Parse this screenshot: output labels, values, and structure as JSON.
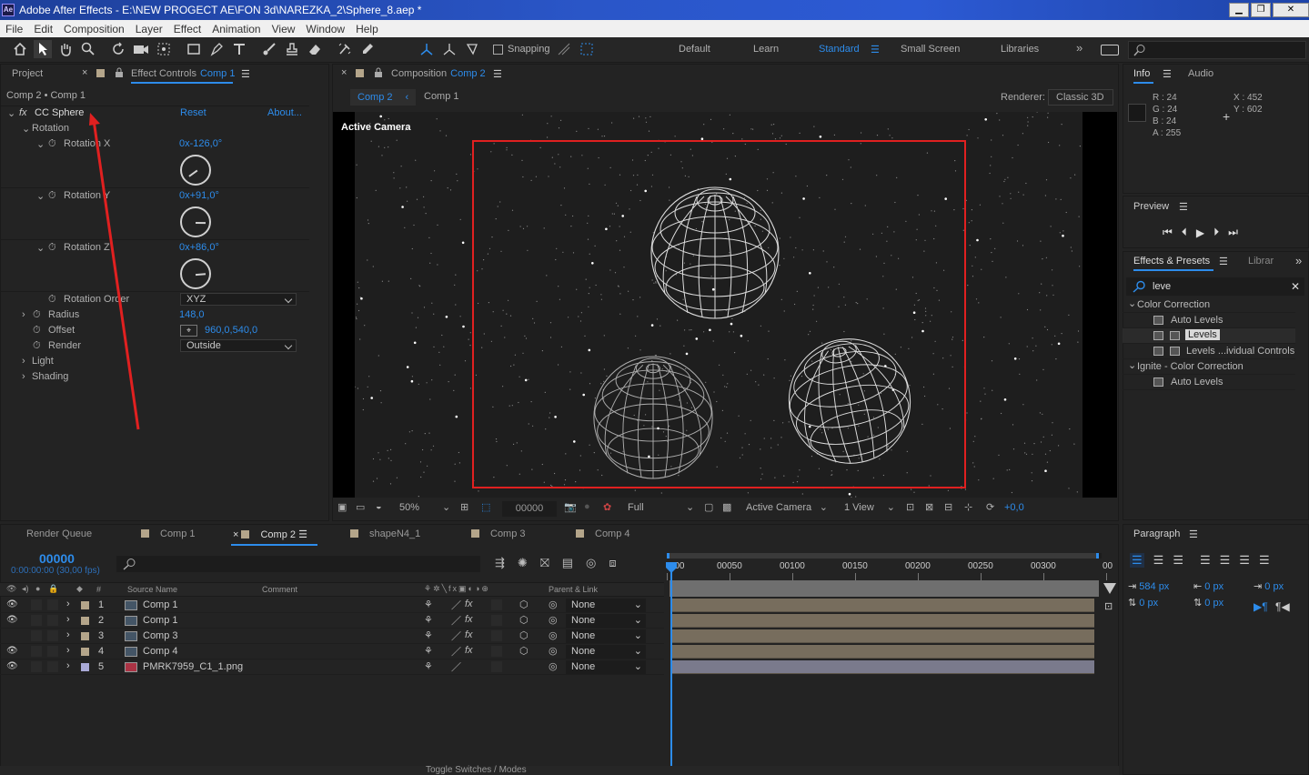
{
  "window": {
    "title": "Adobe After Effects - E:\\NEW PROGECT AE\\FON 3d\\NAREZKA_2\\Sphere_8.aep *",
    "ae_logo": "Ae"
  },
  "menu": [
    "File",
    "Edit",
    "Composition",
    "Layer",
    "Effect",
    "Animation",
    "View",
    "Window",
    "Help"
  ],
  "toolbar": {
    "snapping": "Snapping",
    "workspaces": [
      "Default",
      "Learn",
      "Standard",
      "Small Screen",
      "Libraries"
    ],
    "active_workspace": "Standard"
  },
  "left_panel": {
    "tab_project": "Project",
    "tab_effect_controls": "Effect Controls",
    "effect_controls_comp": "Comp 1",
    "breadcrumb": "Comp 2 • Comp 1",
    "effect_name": "CC Sphere",
    "reset": "Reset",
    "about": "About...",
    "rotation_group": "Rotation",
    "rotation_x": {
      "label": "Rotation X",
      "value": "0x-126,0°"
    },
    "rotation_y": {
      "label": "Rotation Y",
      "value": "0x+91,0°"
    },
    "rotation_z": {
      "label": "Rotation Z",
      "value": "0x+86,0°"
    },
    "rotation_order": {
      "label": "Rotation Order",
      "value": "XYZ"
    },
    "radius": {
      "label": "Radius",
      "value": "148,0"
    },
    "offset": {
      "label": "Offset",
      "value": "960,0,540,0"
    },
    "render": {
      "label": "Render",
      "value": "Outside"
    },
    "light": "Light",
    "shading": "Shading"
  },
  "composition": {
    "panel_title": "Composition",
    "comp_name": "Comp 2",
    "flow_active": "Comp 2",
    "flow_other": "Comp 1",
    "renderer_label": "Renderer:",
    "renderer_value": "Classic 3D",
    "active_camera": "Active Camera",
    "footer": {
      "zoom": "50%",
      "timecode": "00000",
      "resolution": "Full",
      "camera": "Active Camera",
      "views": "1 View",
      "exposure": "+0,0"
    }
  },
  "info_panel": {
    "tab_info": "Info",
    "tab_audio": "Audio",
    "r": "R : 24",
    "g": "G : 24",
    "b": "B : 24",
    "a": "A : 255",
    "x": "X : 452",
    "y": "Y : 602"
  },
  "preview_panel": {
    "title": "Preview"
  },
  "effects_presets": {
    "title": "Effects & Presets",
    "tab_libraries": "Librar",
    "search": "leve",
    "items": [
      {
        "kind": "group",
        "label": "Color Correction"
      },
      {
        "kind": "item",
        "label": "Auto Levels"
      },
      {
        "kind": "item",
        "label": "Levels",
        "selected": true
      },
      {
        "kind": "item",
        "label": "Levels ...ividual Controls"
      },
      {
        "kind": "group",
        "label": "Ignite - Color Correction"
      },
      {
        "kind": "item",
        "label": "Auto Levels"
      }
    ]
  },
  "timeline": {
    "tabs": [
      "Render Queue",
      "Comp 1",
      "Comp 2",
      "shapeN4_1",
      "Comp 3",
      "Comp 4"
    ],
    "active_tab": "Comp 2",
    "timecode": "00000",
    "fps": "0:00:00:00 (30,00 fps)",
    "col_source": "Source Name",
    "col_comment": "Comment",
    "col_parent": "Parent & Link",
    "col_hash": "#",
    "ruler": [
      "0:00",
      "00050",
      "00100",
      "00150",
      "00200",
      "00250",
      "00300",
      "00"
    ],
    "layers": [
      {
        "num": "1",
        "name": "Comp 1",
        "parent": "None",
        "color": "#b4a58a"
      },
      {
        "num": "2",
        "name": "Comp 1",
        "parent": "None",
        "color": "#b4a58a"
      },
      {
        "num": "3",
        "name": "Comp 3",
        "parent": "None",
        "color": "#b4a58a"
      },
      {
        "num": "4",
        "name": "Comp 4",
        "parent": "None",
        "color": "#b4a58a"
      },
      {
        "num": "5",
        "name": "PMRK7959_C1_1.png",
        "parent": "None",
        "color": "#a9a9d6"
      }
    ],
    "toggle": "Toggle Switches / Modes"
  },
  "paragraph": {
    "title": "Paragraph",
    "indent_left": "584 px",
    "indent_right": "0 px",
    "indent_first": "0 px",
    "space_before": "0 px",
    "space_after": "0 px"
  },
  "colors": {
    "accent": "#2d8ceb",
    "annotation": "#e02020"
  }
}
